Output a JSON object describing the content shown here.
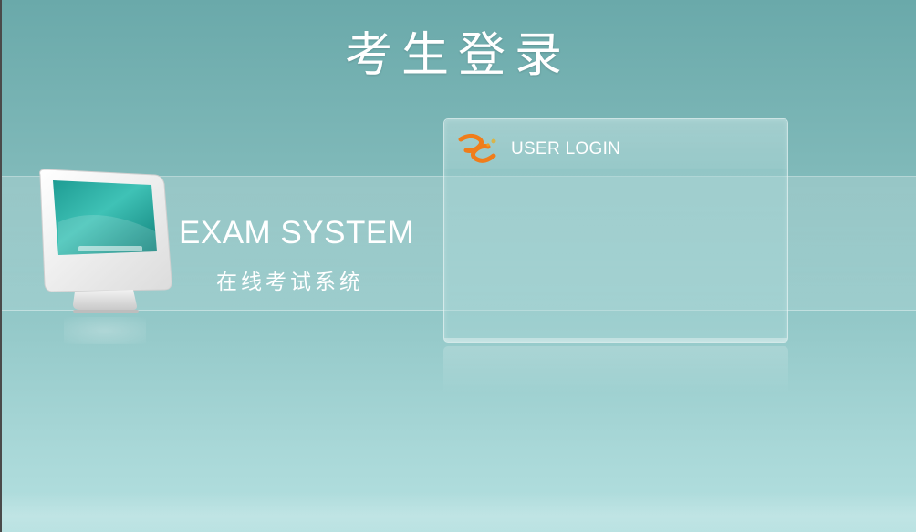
{
  "page": {
    "title": "考生登录"
  },
  "branding": {
    "title": "EXAM SYSTEM",
    "subtitle": "在线考试系统"
  },
  "login": {
    "header_title": "USER LOGIN"
  },
  "colors": {
    "background_top": "#6aa9aa",
    "background_bottom": "#b4e0e0",
    "logo_orange": "#f07d1a",
    "text": "#ffffff"
  },
  "icons": {
    "logo": "logo-icon",
    "monitor": "monitor-icon"
  }
}
